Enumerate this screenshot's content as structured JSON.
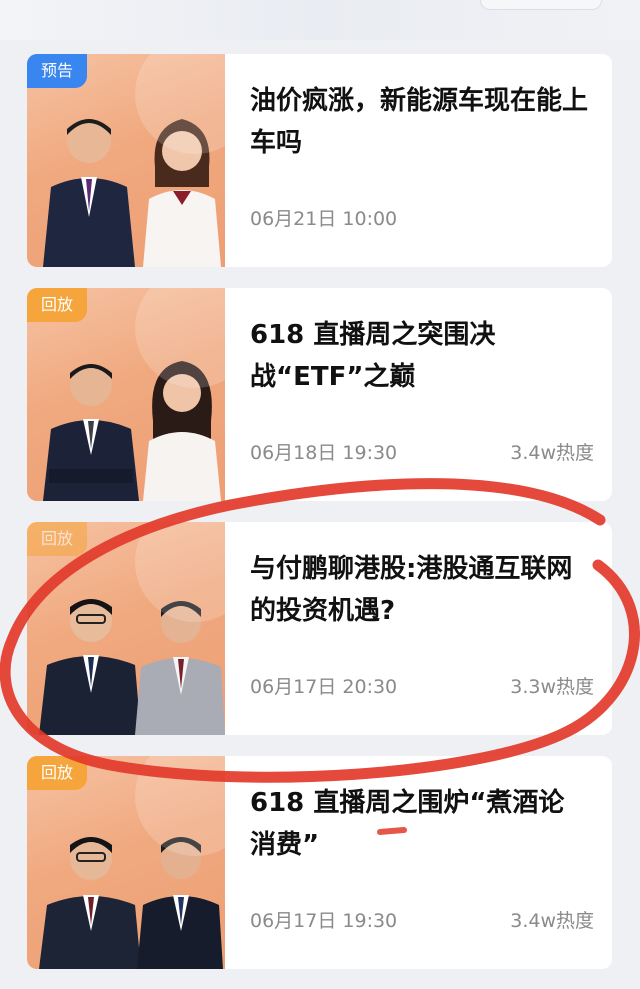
{
  "items": [
    {
      "badge": "预告",
      "title": "油价疯涨，新能源车现在能上车吗",
      "date": "06月21日  10:00",
      "heat": ""
    },
    {
      "badge": "回放",
      "title": "618 直播周之突围决战“ETF”之巅",
      "date": "06月18日  19:30",
      "heat": "3.4w热度"
    },
    {
      "badge": "回放",
      "title": "与付鹏聊港股:港股通互联网的投资机遇?",
      "date": "06月17日  20:30",
      "heat": "3.3w热度"
    },
    {
      "badge": "回放",
      "title": "618 直播周之围炉“煮酒论消费”",
      "date": "06月17日  19:30",
      "heat": "3.4w热度"
    }
  ],
  "colors": {
    "preview_badge": "#3a86f0",
    "replay_badge": "#f5a53b",
    "annotation": "#e23a2a"
  },
  "icons": [
    "person-figure"
  ]
}
